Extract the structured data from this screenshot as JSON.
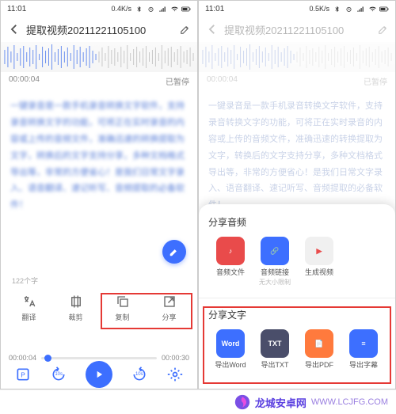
{
  "status": {
    "time": "11:01",
    "net_speed_left": "0.4K/s",
    "net_speed_right": "0.5K/s"
  },
  "header": {
    "title": "提取视频20211221105100"
  },
  "timeline": {
    "current": "00:00:04",
    "status": "已暂停",
    "total": "00:00:30"
  },
  "body_text": "一键录音是一款手机录音转换文字软件，支持录音转换文字的功能，可将正在实时录音的内容或上传的音频文件，准确迅速的转换提取为文字，转换后的文字支持分享，多种文档格式导出等，非常的方便省心！是我们日常文字录入、语音翻译、速记听写、音频提取的必备软件！",
  "left": {
    "word_count": "122个字",
    "actions": [
      {
        "label": "翻译"
      },
      {
        "label": "裁剪"
      },
      {
        "label": "复制"
      },
      {
        "label": "分享"
      }
    ],
    "player": {
      "pos": "00:00:04",
      "total": "00:00:30",
      "back_badge": "10s",
      "fwd_badge": "10s"
    }
  },
  "right_sheet": {
    "audio_title": "分享音频",
    "audio_items": [
      {
        "label": "音频文件",
        "color": "#e94b4b",
        "glyph": "♪"
      },
      {
        "label": "音频链接",
        "sublabel": "无大小限制",
        "color": "#3d6fff",
        "glyph": "🔗"
      },
      {
        "label": "生成视频",
        "color": "#f0f0f0",
        "glyph": "▶",
        "glyph_color": "#e94b4b"
      }
    ],
    "text_title": "分享文字",
    "text_items": [
      {
        "label": "导出Word",
        "color": "#3d6fff",
        "glyph": "Word"
      },
      {
        "label": "导出TXT",
        "color": "#4a4e6a",
        "glyph": "TXT"
      },
      {
        "label": "导出PDF",
        "color": "#ff7a3d",
        "glyph": "📄"
      },
      {
        "label": "导出字幕",
        "color": "#3d6fff",
        "glyph": "≡"
      }
    ]
  },
  "footer": {
    "brand": "龙城安卓网",
    "url": "WWW.LCJFG.COM"
  },
  "colors": {
    "accent": "#3d6fff",
    "highlight": "#e53935"
  }
}
